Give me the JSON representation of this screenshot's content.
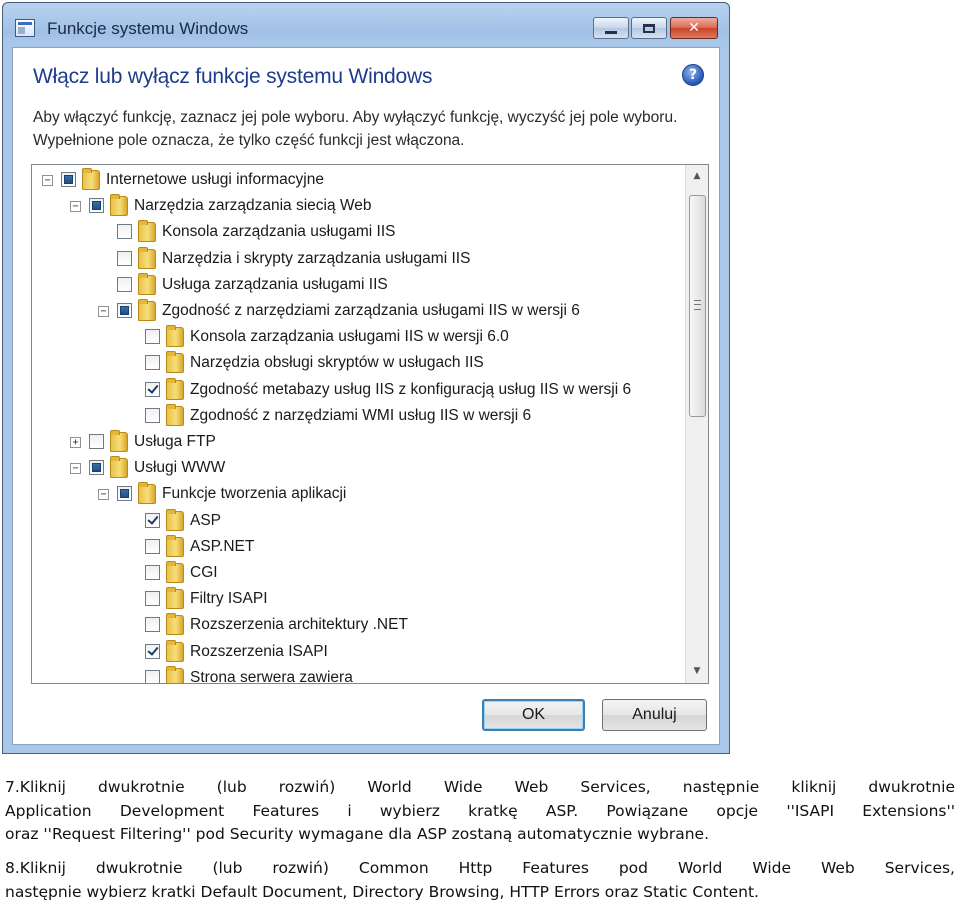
{
  "window": {
    "title": "Funkcje systemu Windows",
    "close_glyph": "✕"
  },
  "dialog": {
    "heading": "Włącz lub wyłącz funkcje systemu Windows",
    "help_glyph": "?",
    "description": "Aby włączyć funkcję, zaznacz jej pole wyboru. Aby wyłączyć funkcję, wyczyść jej pole wyboru. Wypełnione pole oznacza, że tylko część funkcji jest włączona.",
    "ok_label": "OK",
    "cancel_label": "Anuluj"
  },
  "tree": {
    "items": [
      {
        "label": "Internetowe usługi informacyjne",
        "level": 0,
        "expander": "minus",
        "state": "partial"
      },
      {
        "label": "Narzędzia zarządzania siecią Web",
        "level": 1,
        "expander": "minus",
        "state": "partial"
      },
      {
        "label": "Konsola zarządzania usługami IIS",
        "level": 2,
        "expander": "none",
        "state": "unchecked"
      },
      {
        "label": "Narzędzia i skrypty zarządzania usługami IIS",
        "level": 2,
        "expander": "none",
        "state": "unchecked"
      },
      {
        "label": "Usługa zarządzania usługami IIS",
        "level": 2,
        "expander": "none",
        "state": "unchecked"
      },
      {
        "label": "Zgodność z narzędziami zarządzania usługami IIS w wersji 6",
        "level": 2,
        "expander": "minus",
        "state": "partial"
      },
      {
        "label": "Konsola zarządzania usługami IIS w wersji 6.0",
        "level": 3,
        "expander": "none",
        "state": "unchecked"
      },
      {
        "label": "Narzędzia obsługi skryptów w usługach IIS",
        "level": 3,
        "expander": "none",
        "state": "unchecked"
      },
      {
        "label": "Zgodność metabazy usług IIS z konfiguracją usług IIS w wersji 6",
        "level": 3,
        "expander": "none",
        "state": "checked"
      },
      {
        "label": "Zgodność z narzędziami WMI usług IIS w wersji 6",
        "level": 3,
        "expander": "none",
        "state": "unchecked"
      },
      {
        "label": "Usługa FTP",
        "level": 1,
        "expander": "plus",
        "state": "unchecked"
      },
      {
        "label": "Usługi WWW",
        "level": 1,
        "expander": "minus",
        "state": "partial"
      },
      {
        "label": "Funkcje tworzenia aplikacji",
        "level": 2,
        "expander": "minus",
        "state": "partial"
      },
      {
        "label": "ASP",
        "level": 3,
        "expander": "none",
        "state": "checked"
      },
      {
        "label": "ASP.NET",
        "level": 3,
        "expander": "none",
        "state": "unchecked"
      },
      {
        "label": "CGI",
        "level": 3,
        "expander": "none",
        "state": "unchecked"
      },
      {
        "label": "Filtry ISAPI",
        "level": 3,
        "expander": "none",
        "state": "unchecked"
      },
      {
        "label": "Rozszerzenia architektury .NET",
        "level": 3,
        "expander": "none",
        "state": "unchecked"
      },
      {
        "label": "Rozszerzenia ISAPI",
        "level": 3,
        "expander": "none",
        "state": "checked"
      },
      {
        "label": "Strona serwera zawiera",
        "level": 3,
        "expander": "none",
        "state": "unchecked"
      }
    ],
    "scroll_up_glyph": "▲",
    "scroll_down_glyph": "▼"
  },
  "instructions": {
    "step7": [
      "7.Kliknij dwukrotnie (lub rozwiń) World Wide Web Services, następnie kliknij dwukrotnie",
      "Application Development Features i wybierz kratkę ASP. Powiązane opcje ''ISAPI Extensions''",
      "oraz ''Request Filtering'' pod Security wymagane dla ASP zostaną automatycznie wybrane."
    ],
    "step8": [
      "8.Kliknij dwukrotnie (lub rozwiń) Common Http Features pod World Wide Web Services,",
      "następnie wybierz kratki Default Document, Directory Browsing, HTTP Errors oraz Static Content."
    ]
  },
  "colors": {
    "heading": "#1e3c8c",
    "ok_border": "#3c7fb1",
    "close_button": "#c8432a"
  }
}
